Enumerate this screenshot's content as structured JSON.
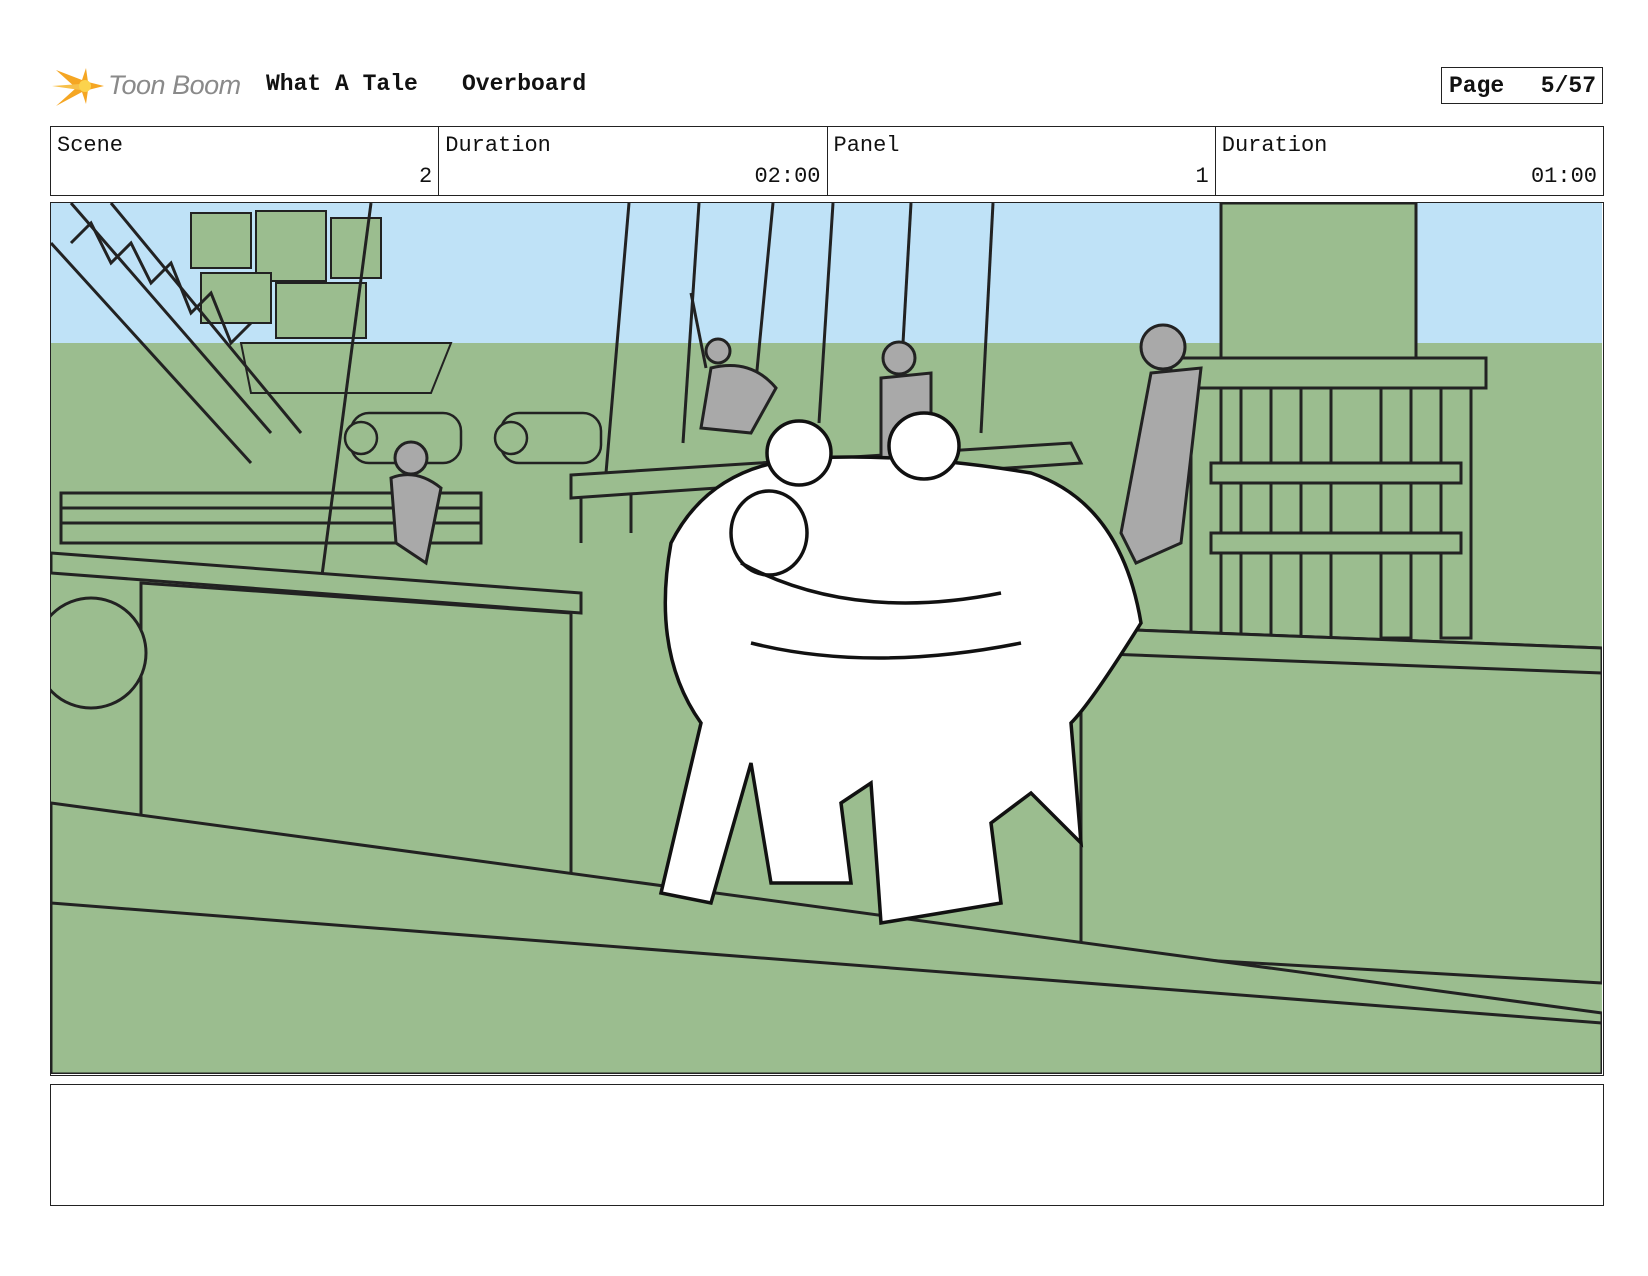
{
  "header": {
    "logo_text": "Toon Boom",
    "project_title": "What A Tale",
    "scene_name": "Overboard",
    "page_label": "Page",
    "page_value": "5/57"
  },
  "info": {
    "scene_label": "Scene",
    "scene_value": "2",
    "scene_duration_label": "Duration",
    "scene_duration_value": "02:00",
    "panel_label": "Panel",
    "panel_value": "1",
    "panel_duration_label": "Duration",
    "panel_duration_value": "01:00"
  },
  "colors": {
    "sky": "#bfe2f7",
    "ship_green": "#9bbd8f",
    "figure_gray": "#a9a9a9",
    "logo_orange": "#f5a623"
  },
  "notes": {
    "text": ""
  }
}
